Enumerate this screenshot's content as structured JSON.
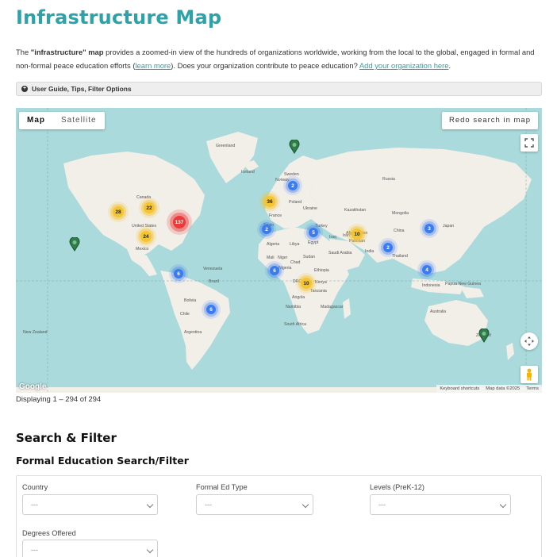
{
  "page": {
    "title": "Infrastructure Map",
    "intro_prefix": "The ",
    "intro_bold": "\"infrastructure\" map",
    "intro_mid": " provides a zoomed-in view of the hundreds of organizations worldwide, working from the local to the global, engaged in formal and non-formal peace education efforts (",
    "learn_more": "learn more",
    "intro_mid2": "). Does your organization contribute to peace education? ",
    "add_org": "Add your organization here",
    "intro_end": ".",
    "guide_label": "User Guide, Tips, Filter Options"
  },
  "map": {
    "type_map": "Map",
    "type_satellite": "Satellite",
    "redo_search": "Redo search in map",
    "google": "Google",
    "attrib_shortcuts": "Keyboard shortcuts",
    "attrib_data": "Map data ©2025",
    "attrib_terms": "Terms",
    "colors": {
      "water": "#aadadb",
      "land": "#f2efe9",
      "cluster_blue": "#3a7bf0",
      "cluster_yellow": "#f4c431",
      "cluster_red": "#ea3b3b",
      "pin_green": "#2f7d4a"
    },
    "labels": {
      "greenland": "Greenland",
      "iceland": "Iceland",
      "canada": "Canada",
      "united_states": "United States",
      "mexico": "Mexico",
      "venezuela": "Venezuela",
      "brazil": "Brazil",
      "bolivia": "Bolivia",
      "chile": "Chile",
      "argentina": "Argentina",
      "sweden": "Sweden",
      "norway": "Norway",
      "poland": "Poland",
      "ukraine": "Ukraine",
      "france": "France",
      "spain": "Spain",
      "russia": "Russia",
      "kazakhstan": "Kazakhstan",
      "mongolia": "Mongolia",
      "china": "China",
      "japan": "Japan",
      "turkey": "Turkey",
      "iraq": "Iraq",
      "iran": "Iran",
      "afghanistan": "Afghanistan",
      "pakistan": "Pakistan",
      "india": "India",
      "thailand": "Thailand",
      "algeria": "Algeria",
      "libya": "Libya",
      "egypt": "Egypt",
      "mali": "Mali",
      "niger": "Niger",
      "chad": "Chad",
      "sudan": "Sudan",
      "ethiopia": "Ethiopia",
      "nigeria": "Nigeria",
      "kenya": "Kenya",
      "drc": "DRC",
      "tanzania": "Tanzania",
      "angola": "Angola",
      "namibia": "Namibia",
      "madagascar": "Madagascar",
      "south_africa": "South Africa",
      "saudi": "Saudi Arabia",
      "indonesia": "Indonesia",
      "papua": "Papua New Guinea",
      "australia": "Australia",
      "new_zealand": "New Zealand",
      "zealand": "Zealand"
    },
    "clusters": [
      {
        "id": "canada-west",
        "count": "28",
        "color": "yellow"
      },
      {
        "id": "canada",
        "count": "22",
        "color": "yellow"
      },
      {
        "id": "usa-east",
        "count": "137",
        "color": "red"
      },
      {
        "id": "usa-south",
        "count": "24",
        "color": "yellow"
      },
      {
        "id": "north-sea",
        "count": "2",
        "color": "blue"
      },
      {
        "id": "europe",
        "count": "36",
        "color": "yellow"
      },
      {
        "id": "mediterranean",
        "count": "2",
        "color": "blue"
      },
      {
        "id": "turkey",
        "count": "5",
        "color": "blue"
      },
      {
        "id": "middle-east",
        "count": "10",
        "color": "yellow"
      },
      {
        "id": "south-asia",
        "count": "2",
        "color": "blue"
      },
      {
        "id": "east-asia",
        "count": "3",
        "color": "blue"
      },
      {
        "id": "west-africa",
        "count": "6",
        "color": "blue"
      },
      {
        "id": "east-africa",
        "count": "10",
        "color": "yellow"
      },
      {
        "id": "southeast-asia",
        "count": "4",
        "color": "blue"
      },
      {
        "id": "colombia",
        "count": "6",
        "color": "blue"
      },
      {
        "id": "south-brazil",
        "count": "6",
        "color": "blue"
      }
    ]
  },
  "results": {
    "displaying": "Displaying 1 – 294 of 294"
  },
  "search": {
    "heading": "Search & Filter",
    "formal_heading": "Formal Education Search/Filter",
    "country_label": "Country",
    "country_value": "---",
    "formal_type_label": "Formal Ed Type",
    "formal_type_value": "---",
    "levels_label": "Levels (PreK-12)",
    "levels_value": "---",
    "degrees_label": "Degrees Offered",
    "degrees_value": "---"
  }
}
